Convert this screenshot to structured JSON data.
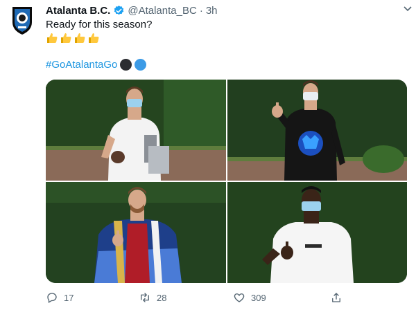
{
  "tweet": {
    "author_name": "Atalanta B.C.",
    "handle": "@Atalanta_BC",
    "separator": "·",
    "time": "3h",
    "text": "Ready for this season?",
    "emojis": [
      "thumbs-up-emoji",
      "thumbs-up-emoji",
      "thumbs-up-emoji",
      "thumbs-up-emoji"
    ],
    "hashtag": "#GoAtalantaGo",
    "hashflag_colors": [
      "#2b2d31",
      "#3c9be6"
    ]
  },
  "photos": [
    {
      "subject": "player-white-shirt-with-ball"
    },
    {
      "subject": "player-black-sweatshirt-thumbs-up"
    },
    {
      "subject": "player-windbreaker-thumbs-up"
    },
    {
      "subject": "player-white-tshirt-thumbs-up"
    }
  ],
  "actions": {
    "reply_count": "17",
    "retweet_count": "28",
    "like_count": "309"
  },
  "colors": {
    "link": "#1b95e0",
    "muted": "#536471",
    "verified": "#1da1f2"
  }
}
